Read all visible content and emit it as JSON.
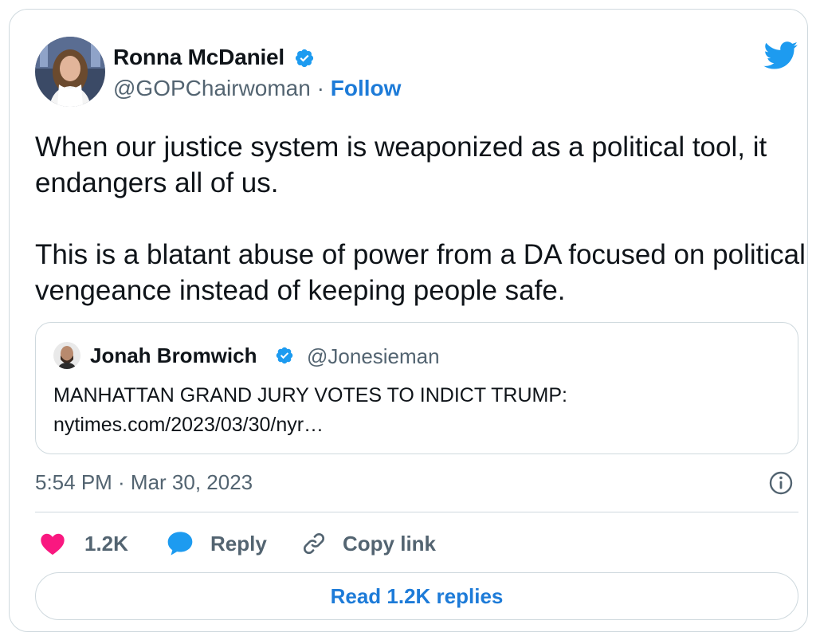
{
  "author": {
    "name": "Ronna McDaniel",
    "handle": "@GOPChairwoman",
    "separator": "·",
    "follow_label": "Follow",
    "avatar_icon": "avatar-photo"
  },
  "tweet": {
    "paragraphs": [
      "When our justice system is weaponized as a political tool, it endangers all of us.",
      "This is a blatant abuse of power from a DA focused on political vengeance instead of keeping people safe."
    ]
  },
  "quote": {
    "name": "Jonah Bromwich",
    "handle": "@Jonesieman",
    "text_line1": "MANHATTAN GRAND JURY VOTES TO INDICT TRUMP:",
    "text_line2": "nytimes.com/2023/03/30/nyr…"
  },
  "timestamp": "5:54 PM · Mar 30, 2023",
  "actions": {
    "like_count": "1.2K",
    "reply_label": "Reply",
    "copy_label": "Copy link"
  },
  "read_replies_label": "Read 1.2K replies",
  "colors": {
    "accent": "#1d7bd8",
    "twitter_blue": "#1d9bf0",
    "like_pink": "#f91880",
    "muted": "#536471",
    "border": "#cfd9de"
  }
}
